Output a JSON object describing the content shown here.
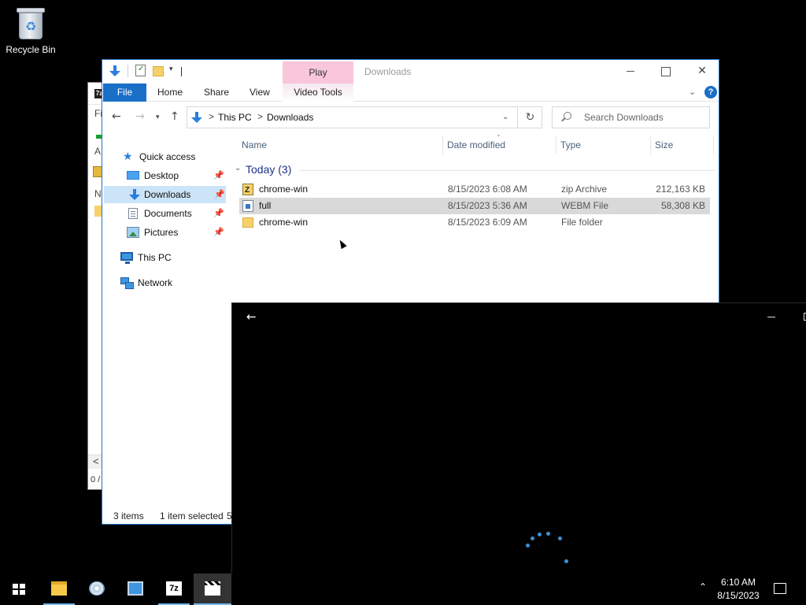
{
  "desktop": {
    "recycle_bin_label": "Recycle Bin"
  },
  "back_window": {
    "icon_label": "7z",
    "frag_fi": "Fi",
    "frag_a": "A",
    "frag_n": "N",
    "scroll_left": "<",
    "status": "0 /"
  },
  "explorer": {
    "title": "Downloads",
    "contextual_tab_group": "Play",
    "ribbon_tabs": {
      "file": "File",
      "home": "Home",
      "share": "Share",
      "view": "View",
      "video_tools": "Video Tools"
    },
    "help": "?",
    "address": {
      "crumbs": [
        "This PC",
        "Downloads"
      ],
      "separator": ">"
    },
    "search": {
      "placeholder": "Search Downloads"
    },
    "nav_pane": [
      {
        "label": "Quick access",
        "icon": "star-icon"
      },
      {
        "label": "Desktop",
        "icon": "desktop-icon",
        "pinned": true
      },
      {
        "label": "Downloads",
        "icon": "downloads-icon",
        "pinned": true,
        "selected": true
      },
      {
        "label": "Documents",
        "icon": "documents-icon",
        "pinned": true
      },
      {
        "label": "Pictures",
        "icon": "pictures-icon",
        "pinned": true
      },
      {
        "label": "This PC",
        "icon": "this-pc-icon"
      },
      {
        "label": "Network",
        "icon": "network-icon"
      }
    ],
    "columns": {
      "name": "Name",
      "date_modified": "Date modified",
      "type": "Type",
      "size": "Size"
    },
    "group": {
      "label": "Today (3)"
    },
    "files": [
      {
        "name": "chrome-win",
        "date": "8/15/2023 6:08 AM",
        "type": "zip Archive",
        "size": "212,163 KB",
        "icon": "zip-icon",
        "selected": false
      },
      {
        "name": "full",
        "date": "8/15/2023 5:36 AM",
        "type": "WEBM File",
        "size": "58,308 KB",
        "icon": "video-file-icon",
        "selected": true
      },
      {
        "name": "chrome-win",
        "date": "8/15/2023 6:09 AM",
        "type": "File folder",
        "size": "",
        "icon": "folder-icon",
        "selected": false
      }
    ],
    "status": {
      "items": "3 items",
      "selected": "1 item selected",
      "trunc": "5"
    }
  },
  "player": {
    "back_arrow": "←"
  },
  "taskbar": {
    "apps": [
      {
        "name": "file-explorer",
        "icon": "folder-icon",
        "state": "running"
      },
      {
        "name": "disc-tool",
        "icon": "cd-icon",
        "state": "idle"
      },
      {
        "name": "computer-tool",
        "icon": "computer-icon",
        "state": "idle"
      },
      {
        "name": "7zip",
        "icon": "7zip-icon",
        "state": "running"
      },
      {
        "name": "movies-tv",
        "icon": "clapperboard-icon",
        "state": "active"
      }
    ],
    "seven_zip_label": "7z",
    "time": "6:10 AM",
    "date": "8/15/2023"
  }
}
